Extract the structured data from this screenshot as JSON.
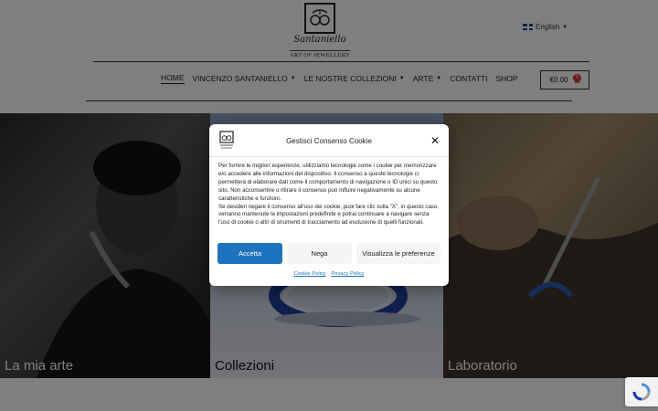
{
  "header": {
    "logo_signature": "Santaniello",
    "logo_subtitle": "ART OF JEWELLERY",
    "language": "English",
    "cart_amount": "€0.00",
    "cart_count": "0"
  },
  "nav": {
    "items": [
      {
        "label": "HOME",
        "has_dropdown": false
      },
      {
        "label": "VINCENZO SANTANIELLO",
        "has_dropdown": true
      },
      {
        "label": "LE NOSTRE COLLEZIONI",
        "has_dropdown": true
      },
      {
        "label": "ARTE",
        "has_dropdown": true
      },
      {
        "label": "CONTATTI",
        "has_dropdown": false
      },
      {
        "label": "SHOP",
        "has_dropdown": false
      }
    ]
  },
  "tiles": [
    {
      "label": "La mia arte"
    },
    {
      "label": "Collezioni"
    },
    {
      "label": "Laboratorio"
    }
  ],
  "consent": {
    "title": "Gestisci Consenso Cookie",
    "body_1": "Per fornire le migliori esperienze, utilizziamo tecnologie come i cookie per memorizzare e/o accedere alle informazioni del dispositivo. Il consenso a queste tecnologie ci permetterà di elaborare dati come il comportamento di navigazione o ID unici su questo sito. Non acconsentire o ritirare il consenso può influire negativamente su alcune caratteristiche e funzioni.",
    "body_2": "Se desideri negare il consenso all'uso dei cookie, puoi fare clic sulla \"X\", in questo caso, verranno mantenute le impostazioni predefinite e potrai continuare a navigare senza l'uso di cookie o altri di strumenti di tracciamento ad esclusione di quelli funzionali.",
    "accept_label": "Accetta",
    "deny_label": "Nega",
    "prefs_label": "Visualizza le preferenze",
    "cookie_policy_label": "Cookie Policy",
    "privacy_policy_label": "Privacy Policy"
  },
  "colors": {
    "accent": "#1e73be"
  }
}
